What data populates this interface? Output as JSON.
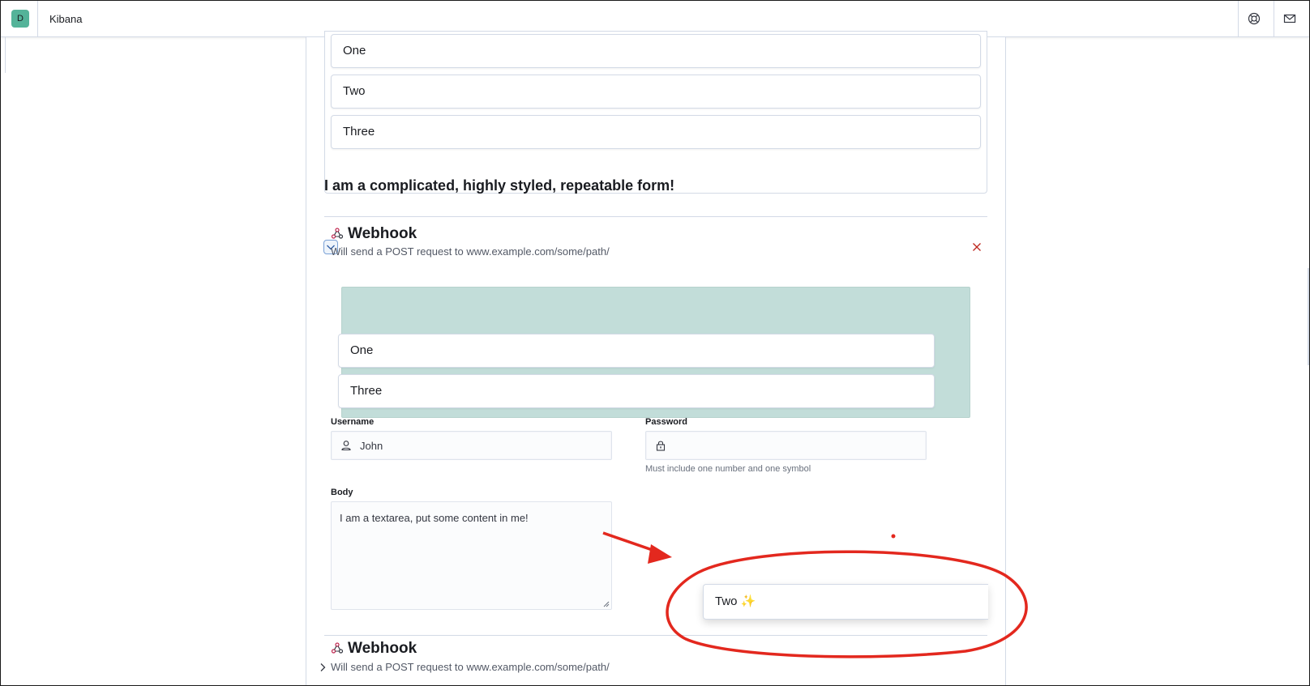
{
  "header": {
    "avatar_initial": "D",
    "app_title": "Kibana",
    "help_icon": "help-lifebuoy-icon",
    "news_icon": "mail-icon"
  },
  "top_list": {
    "items": [
      "One",
      "Two",
      "Three"
    ]
  },
  "form": {
    "title": "I am a complicated, highly styled, repeatable form!"
  },
  "sections": [
    {
      "title": "Webhook",
      "subtitle": "Will send a POST request to www.example.com/some/path/",
      "expanded": true,
      "drop_items": [
        "One",
        "Three"
      ],
      "username": {
        "label": "Username",
        "value": "John"
      },
      "password": {
        "label": "Password",
        "value": "",
        "help": "Must include one number and one symbol"
      },
      "body": {
        "label": "Body",
        "value": "I am a textarea, put some content in me!"
      }
    },
    {
      "title": "Webhook",
      "subtitle": "Will send a POST request to www.example.com/some/path/",
      "expanded": false
    }
  ],
  "dragging_item": {
    "label": "Two",
    "emoji": "✨"
  },
  "colors": {
    "accent": "#54b399",
    "dropzone": "#c2ddd9",
    "danger": "#bd271e",
    "annotation": "#e3281e"
  }
}
